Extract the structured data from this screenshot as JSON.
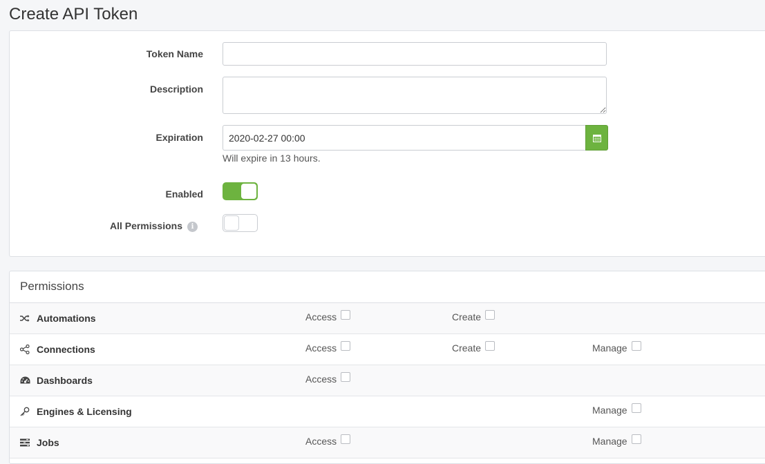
{
  "page": {
    "title": "Create API Token"
  },
  "form": {
    "token_name_label": "Token Name",
    "token_name_value": "",
    "description_label": "Description",
    "description_value": "",
    "expiration_label": "Expiration",
    "expiration_value": "2020-02-27 00:00",
    "expiration_hint": "Will expire in 13 hours.",
    "enabled_label": "Enabled",
    "enabled": true,
    "all_permissions_label": "All Permissions",
    "all_permissions": false,
    "info_glyph": "i"
  },
  "permissions": {
    "title": "Permissions",
    "rows": [
      {
        "name": "Automations",
        "icon": "shuffle-icon",
        "access": "Access",
        "create": "Create",
        "manage": ""
      },
      {
        "name": "Connections",
        "icon": "share-icon",
        "access": "Access",
        "create": "Create",
        "manage": "Manage"
      },
      {
        "name": "Dashboards",
        "icon": "dashboard-icon",
        "access": "Access",
        "create": "",
        "manage": ""
      },
      {
        "name": "Engines & Licensing",
        "icon": "key-icon",
        "access": "",
        "create": "",
        "manage": "Manage"
      },
      {
        "name": "Jobs",
        "icon": "tasks-icon",
        "access": "Access",
        "create": "",
        "manage": "Manage"
      }
    ]
  },
  "colors": {
    "accent": "#6db33f"
  }
}
